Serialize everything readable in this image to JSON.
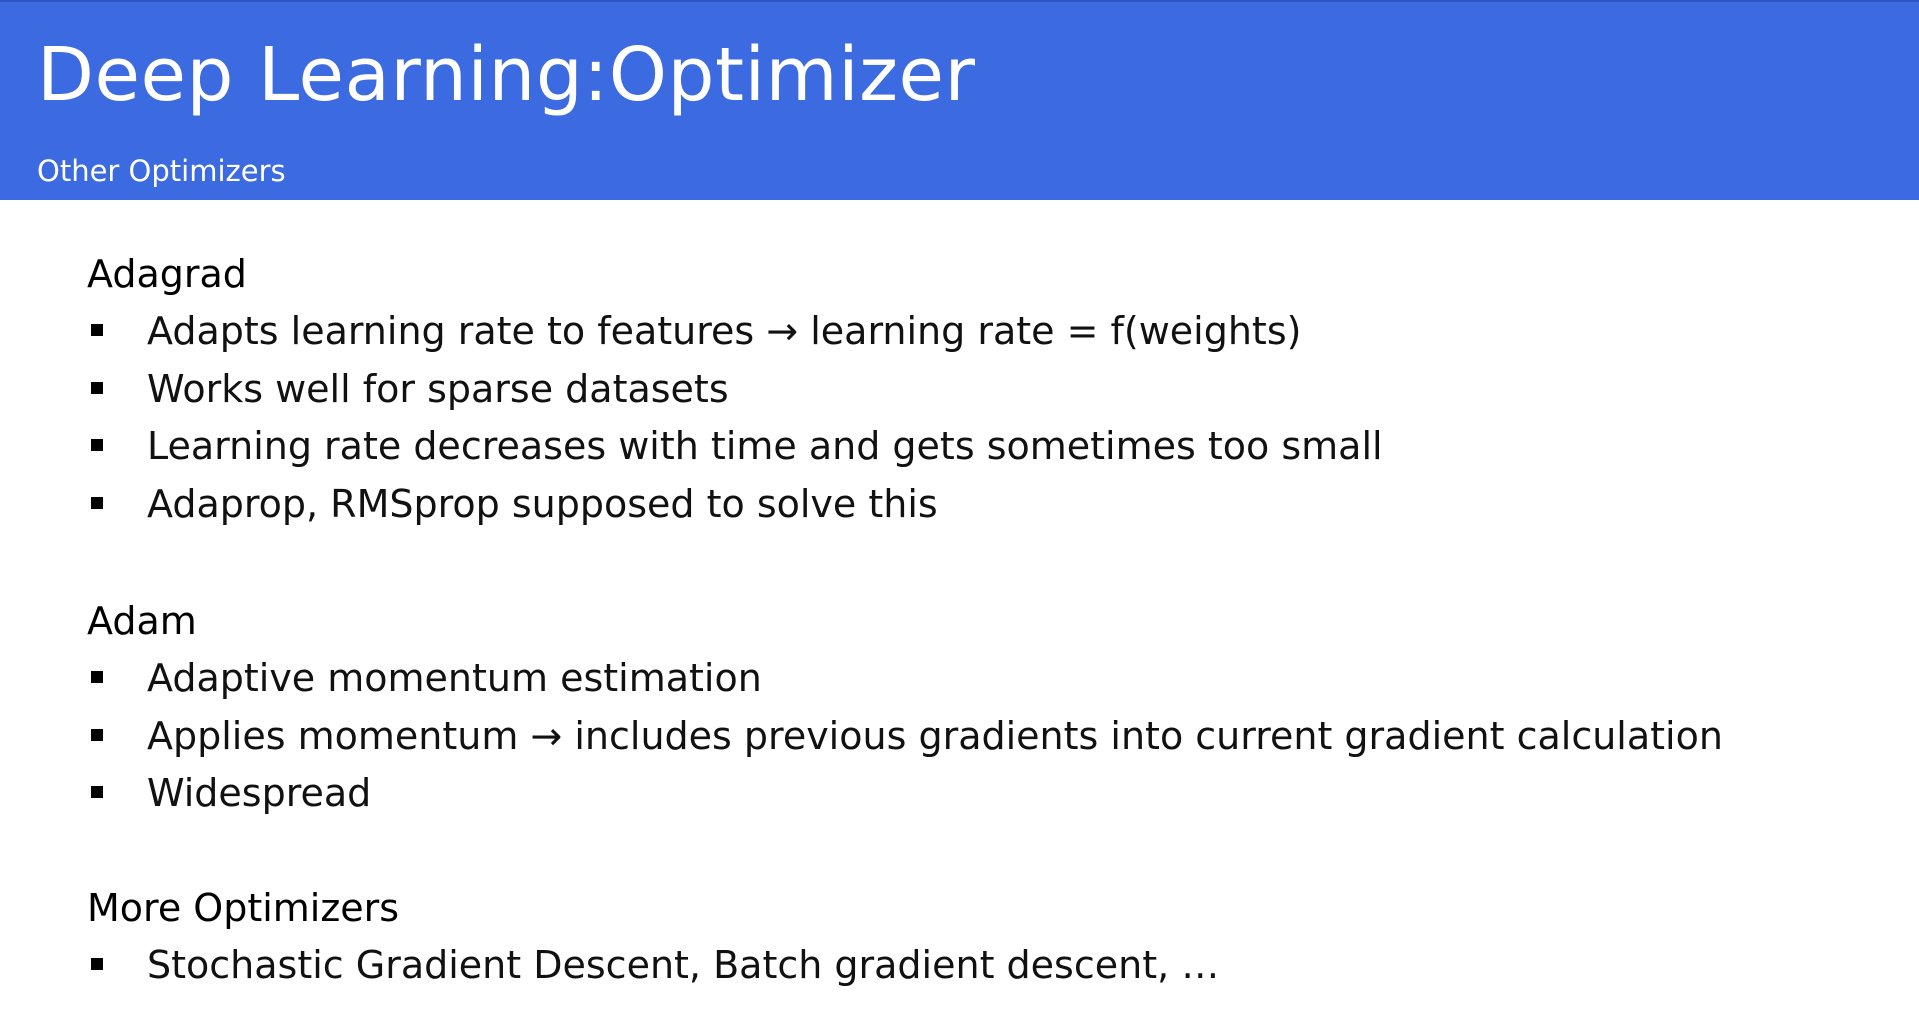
{
  "slide": {
    "title": "Deep Learning:Optimizer",
    "subtitle": "Other Optimizers",
    "colors": {
      "header_background": "#3c6ae0",
      "header_text": "#ffffff",
      "body_text": "#000000"
    }
  },
  "sections": [
    {
      "heading": "Adagrad",
      "bullets": [
        "Adapts learning rate to features → learning rate = f(weights)",
        "Works well for sparse datasets",
        "Learning rate decreases with time and gets sometimes too small",
        "Adaprop, RMSprop supposed to solve this"
      ]
    },
    {
      "heading": "Adam",
      "bullets": [
        "Adaptive momentum estimation",
        "Applies momentum → includes previous gradients into current gradient calculation",
        "Widespread"
      ]
    },
    {
      "heading": "More Optimizers",
      "bullets": [
        "Stochastic Gradient Descent, Batch gradient descent, …"
      ]
    }
  ]
}
